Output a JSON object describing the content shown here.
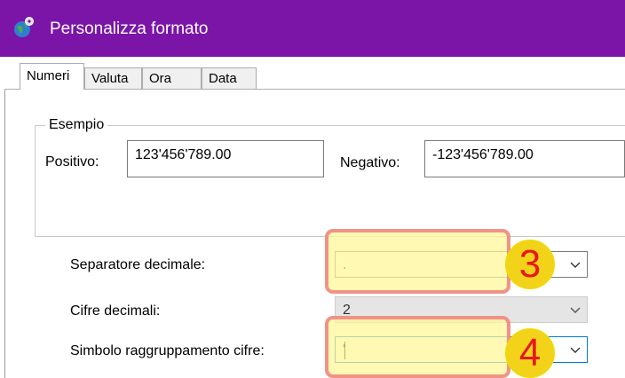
{
  "window": {
    "title": "Personalizza formato",
    "title_bar_color": "#7b15a8",
    "icon": "globe-settings-icon"
  },
  "tabs": [
    {
      "label": "Numeri",
      "active": true
    },
    {
      "label": "Valuta",
      "active": false
    },
    {
      "label": "Ora",
      "active": false
    },
    {
      "label": "Data",
      "active": false
    }
  ],
  "example": {
    "legend": "Esempio",
    "positive_label": "Positivo:",
    "positive_value": "123'456'789.00",
    "negative_label": "Negativo:",
    "negative_value": "-123'456'789.00"
  },
  "settings": {
    "decimal_separator": {
      "label": "Separatore decimale:",
      "value": "."
    },
    "decimal_digits": {
      "label": "Cifre decimali:",
      "value": "2"
    },
    "digit_grouping_symbol": {
      "label": "Simbolo raggruppamento cifre:",
      "value": "'"
    }
  },
  "annotations": [
    {
      "number": "3",
      "target": "decimal_separator"
    },
    {
      "number": "4",
      "target": "digit_grouping_symbol"
    }
  ],
  "colors": {
    "highlight_fill": "#fff696",
    "highlight_border": "#f08080",
    "badge_fill": "#f3d21a",
    "badge_text": "#e8171c",
    "focus_border": "#0078d7"
  }
}
